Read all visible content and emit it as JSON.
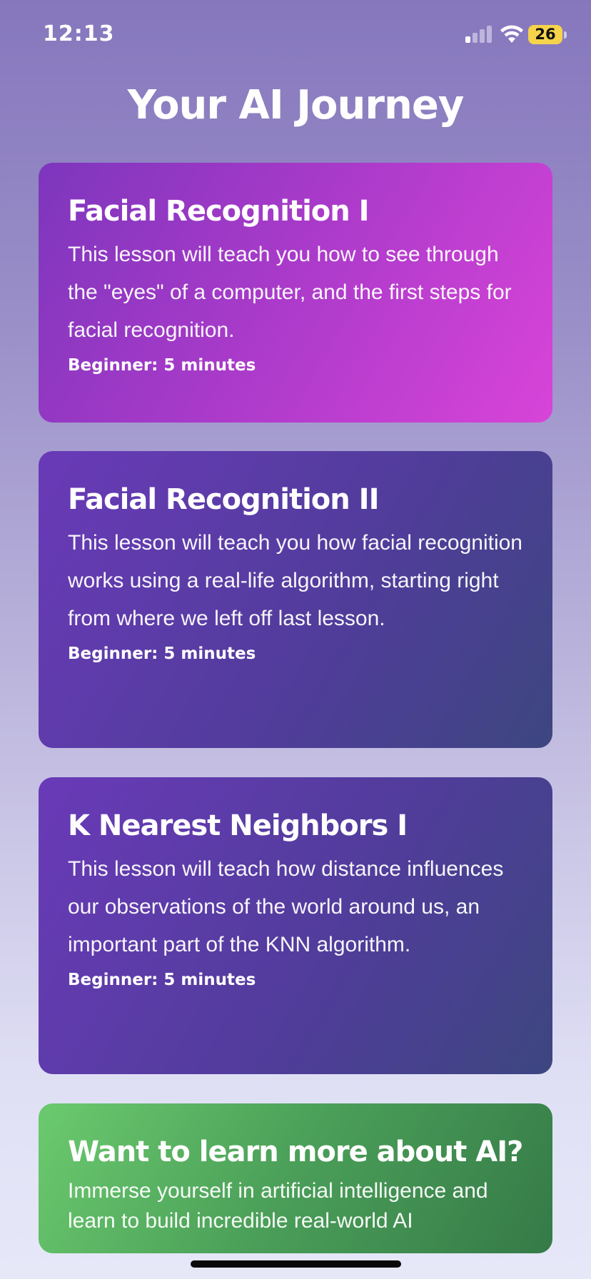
{
  "status_bar": {
    "time": "12:13",
    "battery_level": "26",
    "battery_color": "#f5d34a",
    "signal_bars_active": 1,
    "signal_bars_total": 4,
    "icons": [
      "signal-icon",
      "wifi-icon",
      "battery-icon"
    ]
  },
  "header": {
    "title": "Your AI Journey"
  },
  "lessons": [
    {
      "title": "Facial Recognition I",
      "description": "This lesson will teach you how to see through the \"eyes\" of a computer, and the first steps for facial recognition.",
      "meta": "Beginner: 5 minutes",
      "accent": "#c13fd0"
    },
    {
      "title": "Facial Recognition II",
      "description": "This lesson will teach you how facial recognition works using a real-life algorithm, starting right from where we left off last lesson.",
      "meta": "Beginner: 5 minutes",
      "accent": "#4f3d99"
    },
    {
      "title": "K Nearest Neighbors I",
      "description": "This lesson will teach how distance influences our observations of the world around us, an important part of the KNN algorithm.",
      "meta": "Beginner: 5 minutes",
      "accent": "#4f3d99"
    }
  ],
  "promo": {
    "title": "Want to learn more about AI?",
    "description": "Immerse yourself in artificial intelligence and learn to build incredible real-world AI",
    "accent": "#4a9e58"
  }
}
